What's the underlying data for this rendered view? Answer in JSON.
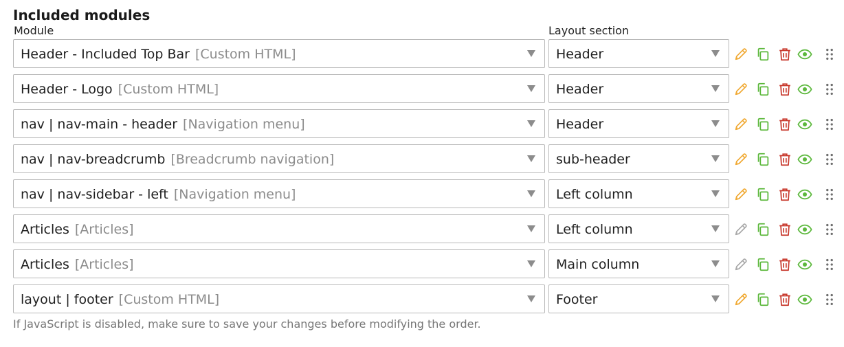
{
  "heading": "Included modules",
  "columns": {
    "module": "Module",
    "section": "Layout section"
  },
  "rows": [
    {
      "module": "Header - Included Top Bar",
      "type": "[Custom HTML]",
      "section": "Header",
      "edit_enabled": true
    },
    {
      "module": "Header - Logo",
      "type": "[Custom HTML]",
      "section": "Header",
      "edit_enabled": true
    },
    {
      "module": "nav | nav-main - header",
      "type": "[Navigation menu]",
      "section": "Header",
      "edit_enabled": true
    },
    {
      "module": "nav | nav-breadcrumb",
      "type": "[Breadcrumb navigation]",
      "section": "sub-header",
      "edit_enabled": true
    },
    {
      "module": "nav | nav-sidebar - left",
      "type": "[Navigation menu]",
      "section": "Left column",
      "edit_enabled": true
    },
    {
      "module": "Articles",
      "type": "[Articles]",
      "section": "Left column",
      "edit_enabled": false
    },
    {
      "module": "Articles",
      "type": "[Articles]",
      "section": "Main column",
      "edit_enabled": false
    },
    {
      "module": "layout | footer",
      "type": "[Custom HTML]",
      "section": "Footer",
      "edit_enabled": true
    }
  ],
  "icons": {
    "edit": "pencil-icon",
    "copy": "copy-icon",
    "delete": "trash-icon",
    "view": "eye-icon",
    "drag": "drag-handle-icon"
  },
  "colors": {
    "edit": "#f0a830",
    "edit_disabled": "#a8a8a8",
    "copy": "#5cb83c",
    "delete": "#c8382c",
    "view": "#5cb83c",
    "drag": "#6e6e6e"
  },
  "footer_note": "If JavaScript is disabled, make sure to save your changes before modifying the order."
}
